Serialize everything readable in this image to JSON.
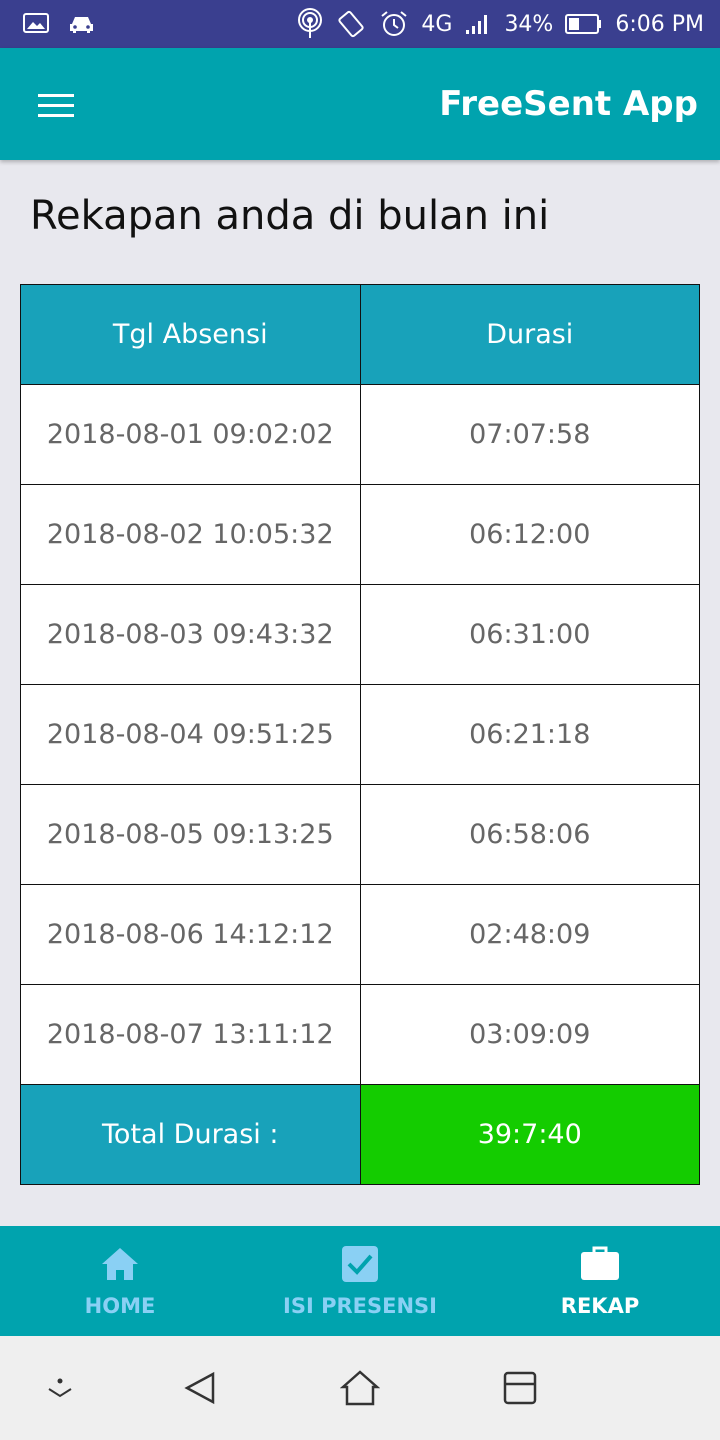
{
  "status_bar": {
    "network": "4G",
    "battery": "34%",
    "time": "6:06 PM",
    "icons": [
      "gallery-icon",
      "car-icon",
      "hotspot-icon",
      "rotate-icon",
      "alarm-icon",
      "signal-icon",
      "battery-icon"
    ]
  },
  "app_bar": {
    "title": "FreeSent App",
    "menu_icon": "hamburger-menu-icon"
  },
  "page": {
    "heading": "Rekapan anda di bulan ini"
  },
  "table": {
    "headers": [
      "Tgl Absensi",
      "Durasi"
    ],
    "rows": [
      {
        "date": "2018-08-01 09:02:02",
        "duration": "07:07:58"
      },
      {
        "date": "2018-08-02 10:05:32",
        "duration": "06:12:00"
      },
      {
        "date": "2018-08-03 09:43:32",
        "duration": "06:31:00"
      },
      {
        "date": "2018-08-04 09:51:25",
        "duration": "06:21:18"
      },
      {
        "date": "2018-08-05 09:13:25",
        "duration": "06:58:06"
      },
      {
        "date": "2018-08-06 14:12:12",
        "duration": "02:48:09"
      },
      {
        "date": "2018-08-07 13:11:12",
        "duration": "03:09:09"
      }
    ],
    "total_label": "Total Durasi :",
    "total_value": "39:7:40"
  },
  "bottom_nav": {
    "items": [
      {
        "label": "HOME",
        "icon": "home-icon",
        "active": false
      },
      {
        "label": "ISI PRESENSI",
        "icon": "checkbox-icon",
        "active": false
      },
      {
        "label": "REKAP",
        "icon": "briefcase-icon",
        "active": true
      }
    ]
  },
  "system_nav": {
    "icons": [
      "dropdown-icon",
      "back-icon",
      "home-icon",
      "recents-icon"
    ]
  },
  "colors": {
    "status_bar": "#3a3f8f",
    "primary": "#00a3ae",
    "table_header": "#18a2ba",
    "total_value": "#14cc00",
    "nav_inactive": "#8ad0f4",
    "background": "#e8e8ee"
  }
}
